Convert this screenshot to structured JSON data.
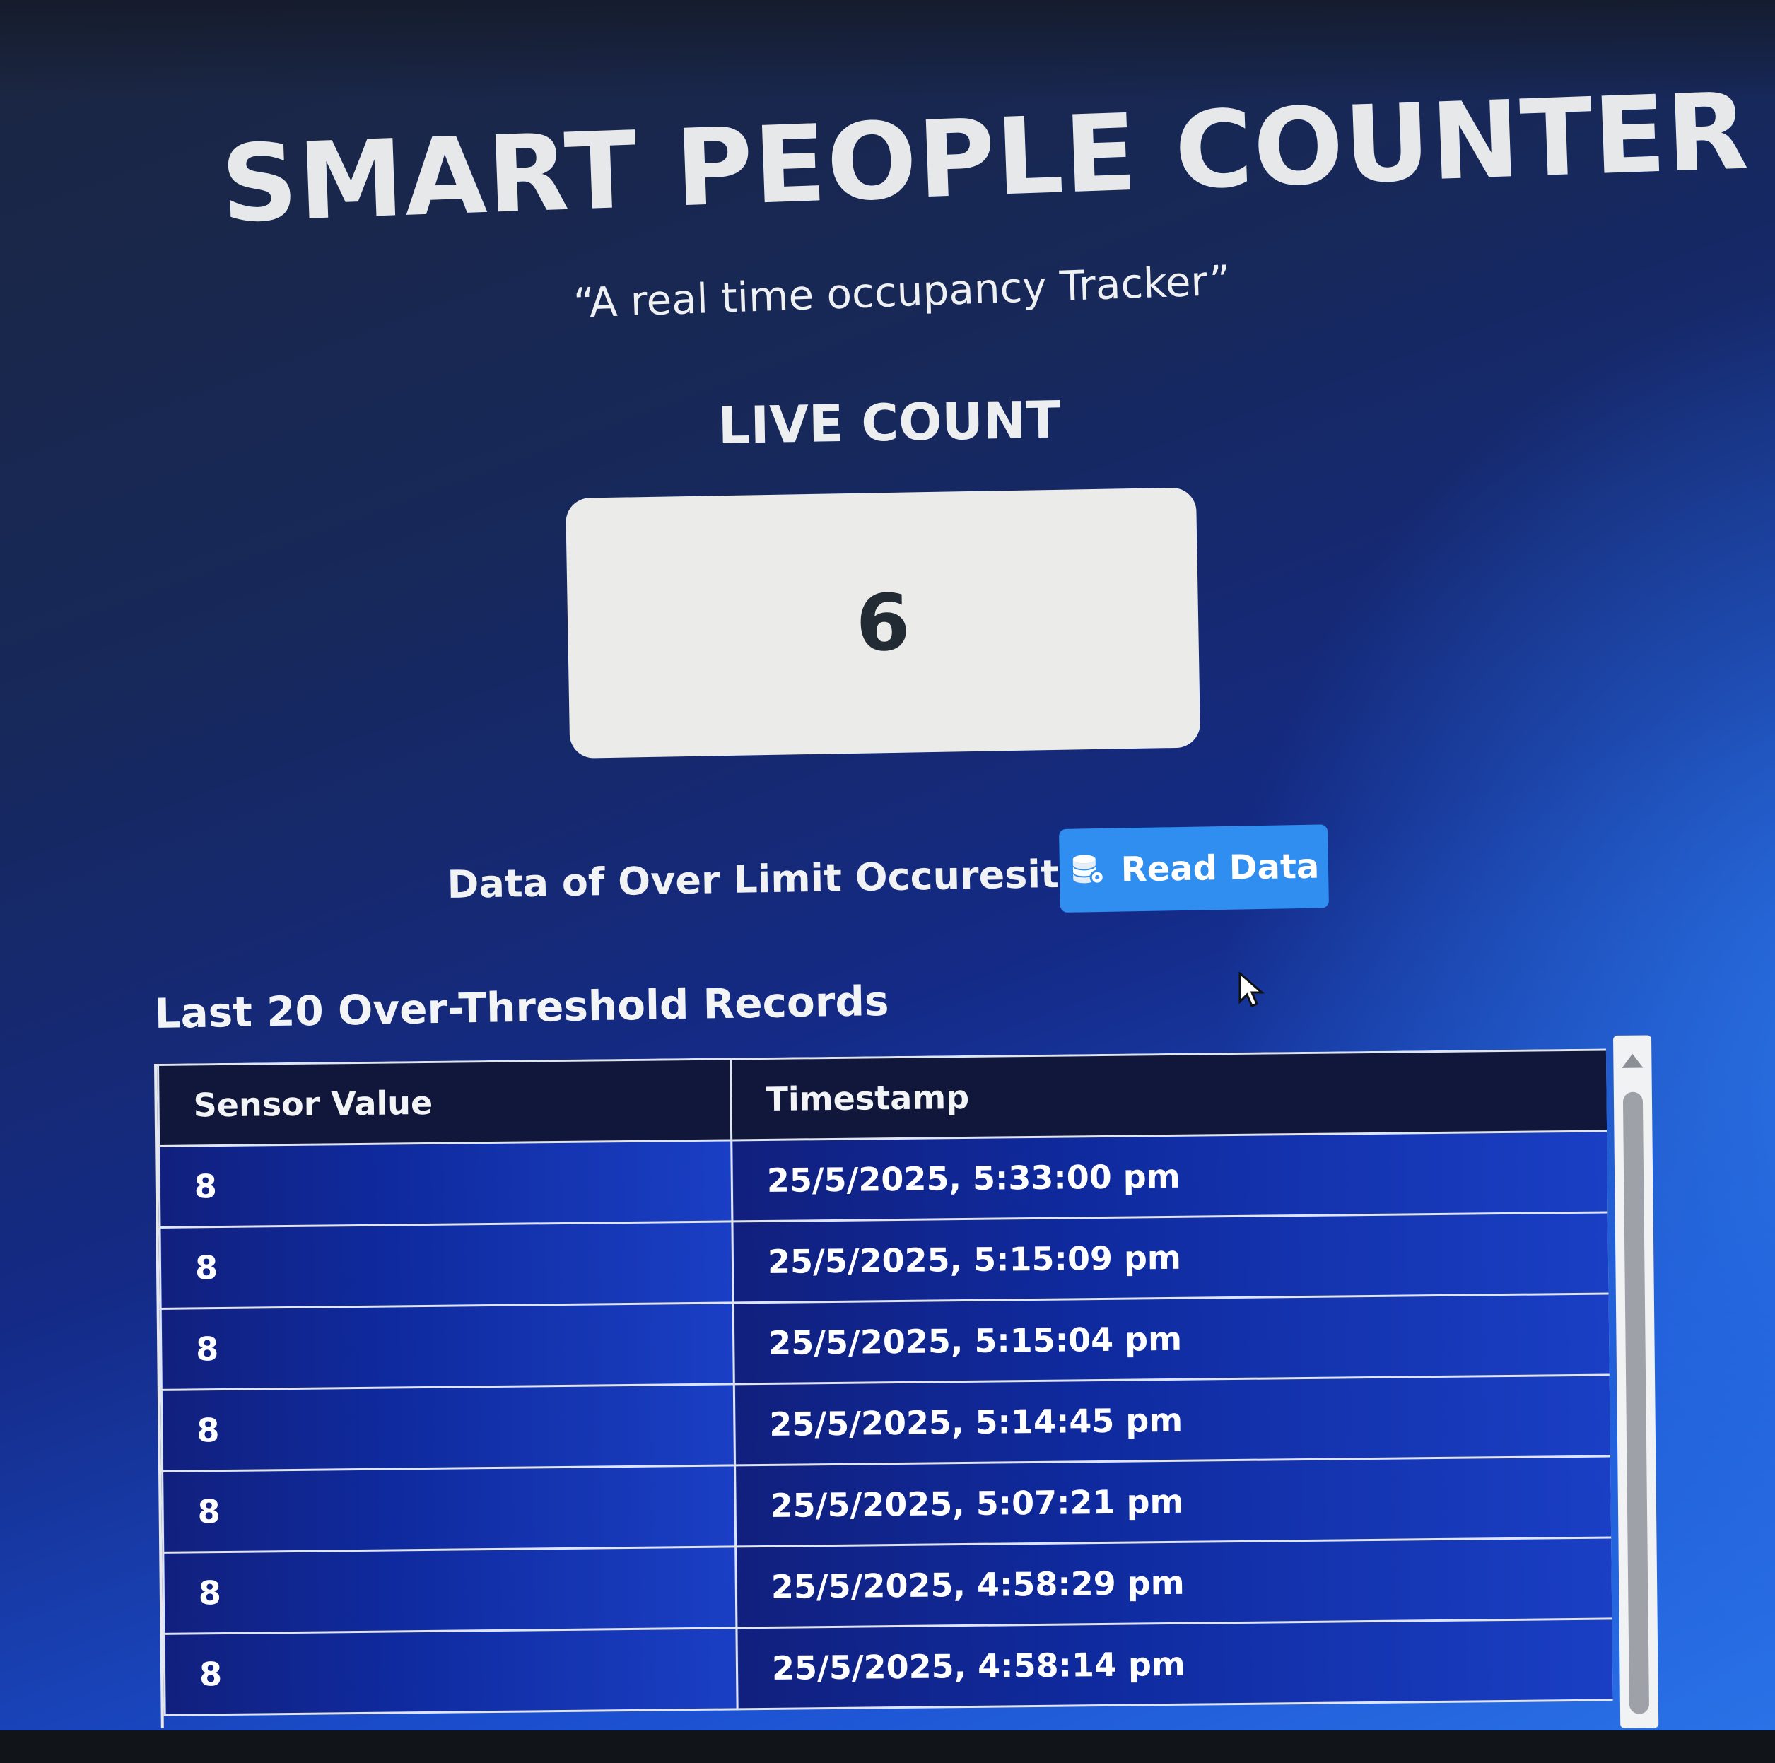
{
  "app": {
    "title": "SMART PEOPLE COUNTER",
    "subtitle": "“A real time occupancy Tracker”"
  },
  "live": {
    "label": "LIVE COUNT",
    "count": "6"
  },
  "read_section": {
    "label": "Data of Over Limit Occuresition :",
    "button_label": "Read Data",
    "button_icon": "database-icon",
    "button_color": "#2f8ef0"
  },
  "records": {
    "heading": "Last 20 Over-Threshold Records",
    "columns": [
      "Sensor Value",
      "Timestamp"
    ],
    "rows": [
      {
        "value": "8",
        "timestamp": "25/5/2025, 5:33:00 pm"
      },
      {
        "value": "8",
        "timestamp": "25/5/2025, 5:15:09 pm"
      },
      {
        "value": "8",
        "timestamp": "25/5/2025, 5:15:04 pm"
      },
      {
        "value": "8",
        "timestamp": "25/5/2025, 5:14:45 pm"
      },
      {
        "value": "8",
        "timestamp": "25/5/2025, 5:07:21 pm"
      },
      {
        "value": "8",
        "timestamp": "25/5/2025, 4:58:29 pm"
      },
      {
        "value": "8",
        "timestamp": "25/5/2025, 4:58:14 pm"
      }
    ]
  },
  "colors": {
    "background_dark": "#17285a",
    "background_light": "#2b74e8",
    "table_header": "#11173a",
    "table_row": "#0f2a9e",
    "count_box": "#ebecea"
  }
}
